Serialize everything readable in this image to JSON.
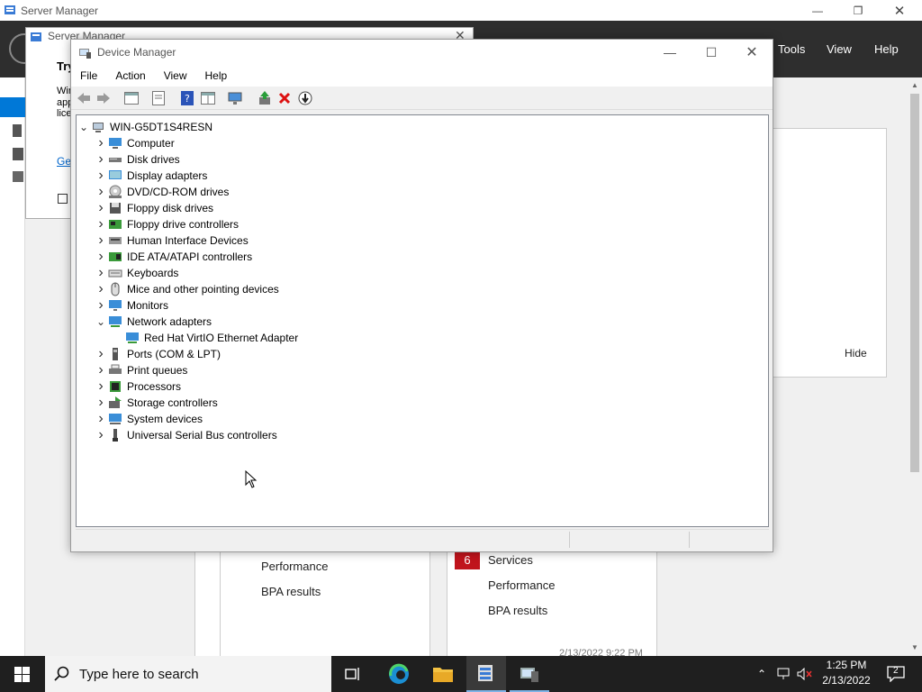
{
  "server_manager": {
    "title": "Server Manager",
    "menu": {
      "tools": "Tools",
      "view": "View",
      "help": "Help"
    },
    "dialog": {
      "title": "Server Manager",
      "heading": "Try",
      "line1": "Wir",
      "line2": "app",
      "line3": "lice",
      "link": "Ge"
    },
    "hide_label": "Hide",
    "tile_left": [
      "Performance",
      "BPA results"
    ],
    "tile_right": {
      "badge": "6",
      "items": [
        "Services",
        "Performance",
        "BPA results"
      ]
    },
    "timestamp": "2/13/2022 9:22 PM"
  },
  "device_manager": {
    "title": "Device Manager",
    "menu": [
      "File",
      "Action",
      "View",
      "Help"
    ],
    "root": "WIN-G5DT1S4RESN",
    "categories": [
      {
        "label": "Computer",
        "icon": "computer-icon"
      },
      {
        "label": "Disk drives",
        "icon": "disk-drive-icon"
      },
      {
        "label": "Display adapters",
        "icon": "display-adapter-icon"
      },
      {
        "label": "DVD/CD-ROM drives",
        "icon": "dvd-drive-icon"
      },
      {
        "label": "Floppy disk drives",
        "icon": "floppy-drive-icon"
      },
      {
        "label": "Floppy drive controllers",
        "icon": "floppy-controller-icon"
      },
      {
        "label": "Human Interface Devices",
        "icon": "hid-icon"
      },
      {
        "label": "IDE ATA/ATAPI controllers",
        "icon": "ide-controller-icon"
      },
      {
        "label": "Keyboards",
        "icon": "keyboard-icon"
      },
      {
        "label": "Mice and other pointing devices",
        "icon": "mouse-icon"
      },
      {
        "label": "Monitors",
        "icon": "monitor-icon"
      },
      {
        "label": "Network adapters",
        "icon": "network-adapter-icon",
        "expanded": true,
        "children": [
          "Red Hat VirtIO Ethernet Adapter"
        ]
      },
      {
        "label": "Ports (COM & LPT)",
        "icon": "port-icon"
      },
      {
        "label": "Print queues",
        "icon": "printer-icon"
      },
      {
        "label": "Processors",
        "icon": "processor-icon"
      },
      {
        "label": "Storage controllers",
        "icon": "storage-controller-icon"
      },
      {
        "label": "System devices",
        "icon": "system-device-icon"
      },
      {
        "label": "Universal Serial Bus controllers",
        "icon": "usb-icon"
      }
    ]
  },
  "taskbar": {
    "search_placeholder": "Type here to search",
    "time": "1:25 PM",
    "date": "2/13/2022",
    "notification_count": "2"
  },
  "colors": {
    "accent": "#0078d7",
    "badge_red": "#c0141c",
    "taskbar": "#1f1f1f"
  }
}
